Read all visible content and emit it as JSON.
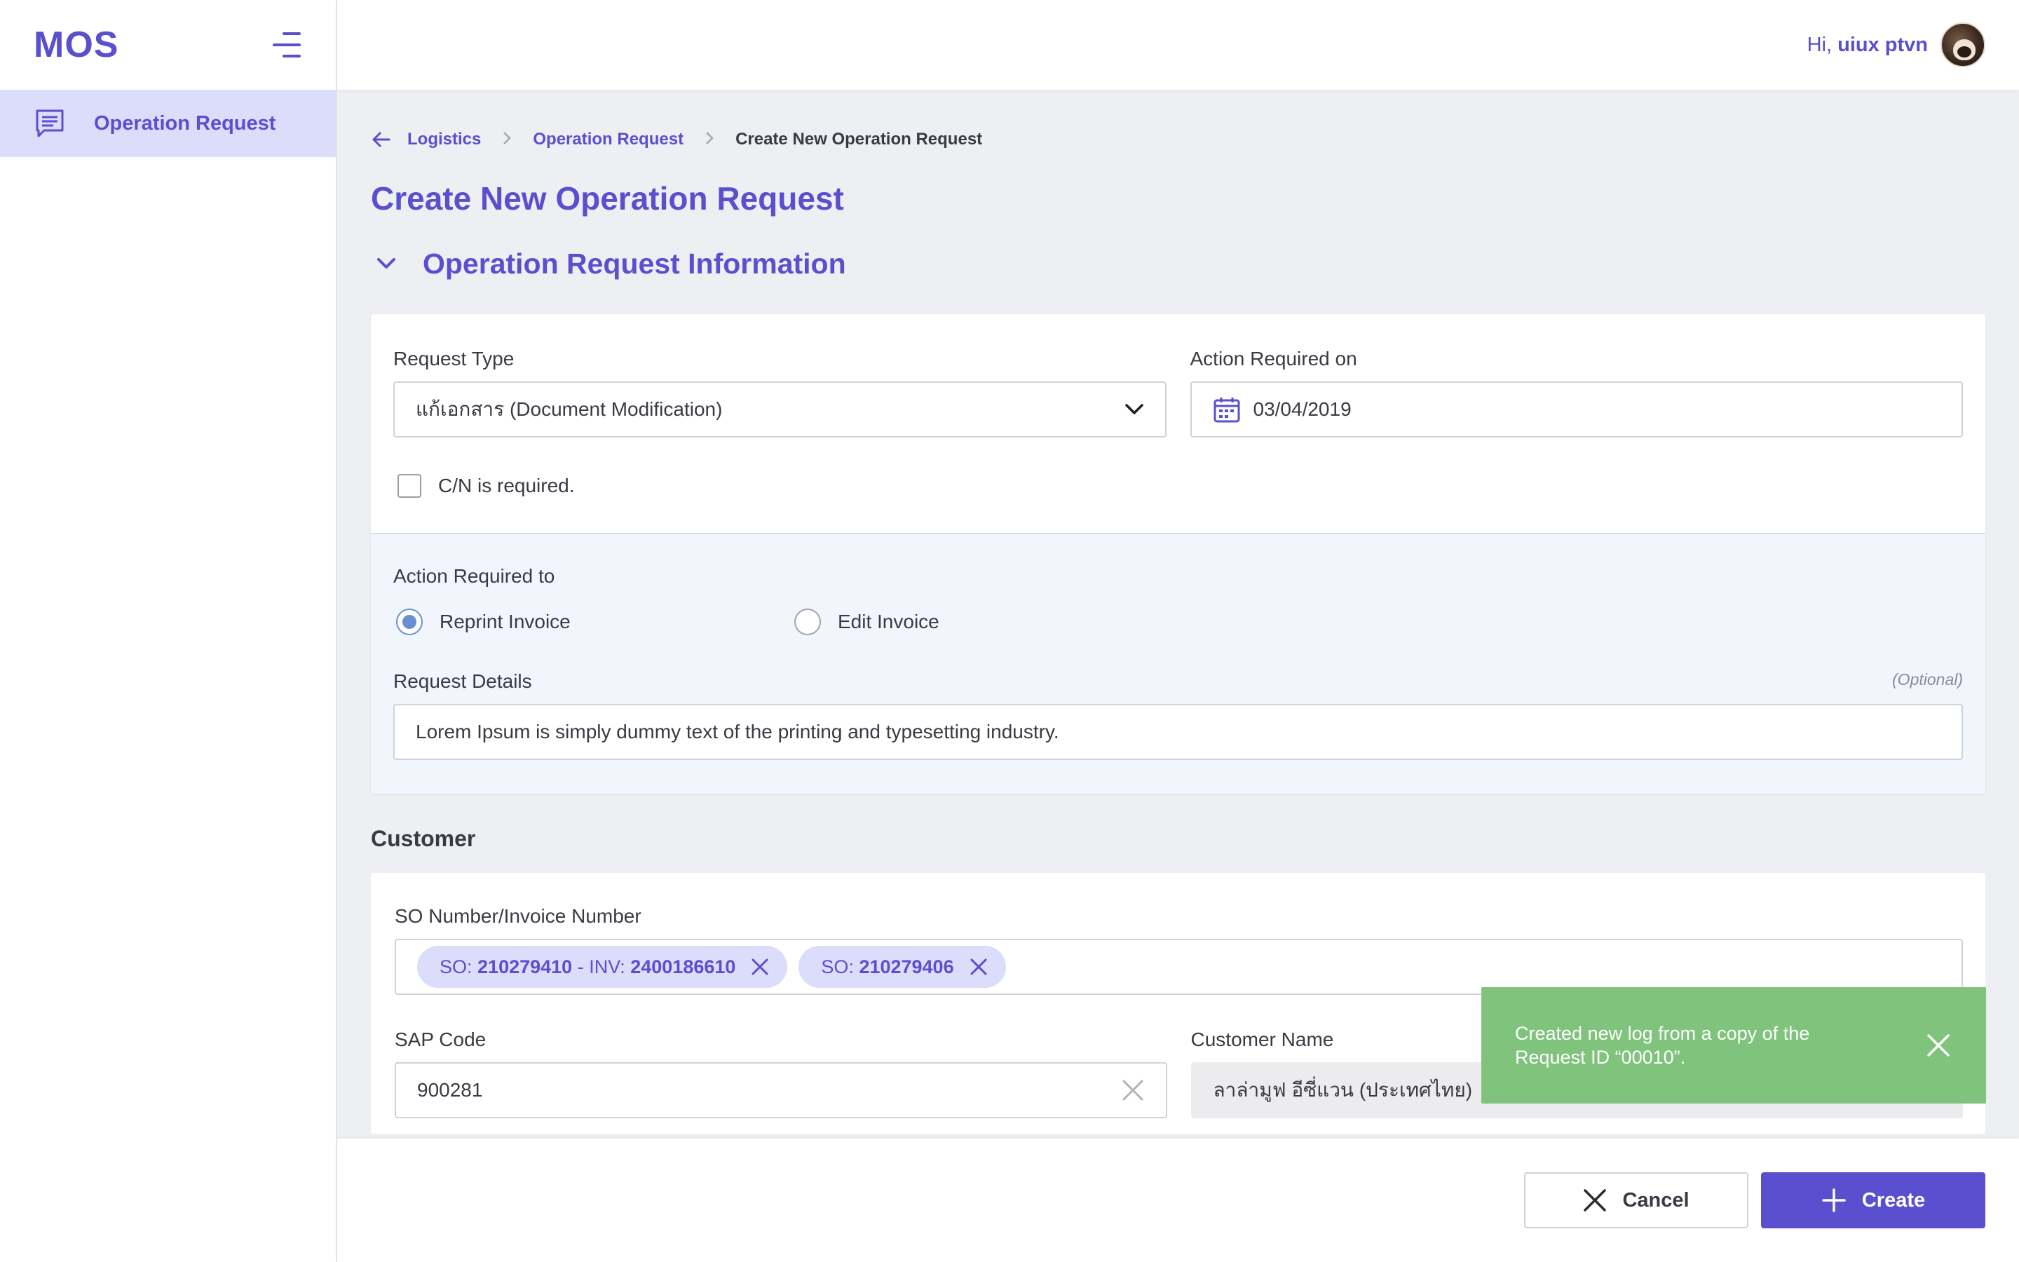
{
  "app": {
    "logo": "MOS"
  },
  "sidebar": {
    "items": [
      {
        "label": "Operation Request",
        "icon": "message-list-icon"
      }
    ]
  },
  "header": {
    "greeting_prefix": "Hi,",
    "username": "uiux ptvn"
  },
  "breadcrumb": {
    "items": [
      "Logistics",
      "Operation Request"
    ],
    "current": "Create New Operation Request"
  },
  "page": {
    "title": "Create New Operation Request"
  },
  "section": {
    "title": "Operation Request Information"
  },
  "form": {
    "request_type": {
      "label": "Request Type",
      "value": "แก้เอกสาร (Document Modification)"
    },
    "action_required_on": {
      "label": "Action Required on",
      "value": "03/04/2019"
    },
    "cn_required": {
      "label": "C/N is required.",
      "checked": false
    },
    "action_required_to": {
      "label": "Action Required to",
      "options": [
        "Reprint Invoice",
        "Edit Invoice"
      ],
      "selected": "Reprint Invoice"
    },
    "request_details": {
      "label": "Request Details",
      "optional": "(Optional)",
      "value": "Lorem Ipsum is simply dummy text of the printing and typesetting industry."
    }
  },
  "customer": {
    "title": "Customer",
    "so_invoice": {
      "label": "SO Number/Invoice Number",
      "chips": [
        {
          "so_prefix": "SO:",
          "so": "210279410",
          "inv_prefix": "- INV:",
          "inv": "2400186610"
        },
        {
          "so_prefix": "SO:",
          "so": "210279406"
        }
      ]
    },
    "sap_code": {
      "label": "SAP Code",
      "value": "900281"
    },
    "customer_name": {
      "label": "Customer Name",
      "value": "ลาล่ามูฟ อีซี่แวน (ประเทศไทย)"
    }
  },
  "toast": {
    "message": "Created new log from a copy of the Request ID “00010”."
  },
  "footer": {
    "cancel_label": "Cancel",
    "create_label": "Create"
  },
  "colors": {
    "brand": "#5a4fcf",
    "toast": "#7fc37d",
    "chip_bg": "#dcdcfb"
  }
}
